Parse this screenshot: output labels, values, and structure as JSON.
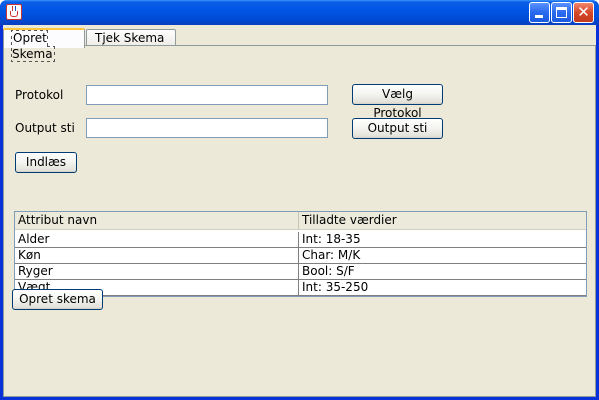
{
  "window": {
    "title": "",
    "icon": "java-cup-icon",
    "controls": [
      "minimize",
      "maximize",
      "close"
    ]
  },
  "tabs": [
    {
      "label": "Opret Skema",
      "active": true
    },
    {
      "label": "Tjek Skema",
      "active": false
    }
  ],
  "form": {
    "protokol_label": "Protokol",
    "protokol_value": "",
    "output_label": "Output sti",
    "output_value": "",
    "choose_protocol_button": "Vælg Protokol",
    "output_button": "Output sti",
    "load_button": "Indlæs"
  },
  "table": {
    "columns": [
      "Attribut navn",
      "Tilladte værdier"
    ],
    "rows": [
      [
        "Alder",
        "Int: 18-35"
      ],
      [
        "Køn",
        "Char: M/K"
      ],
      [
        "Ryger",
        "Bool: S/F"
      ],
      [
        "Vægt",
        "Int: 35-250"
      ]
    ]
  },
  "create_button": "Opret skema"
}
